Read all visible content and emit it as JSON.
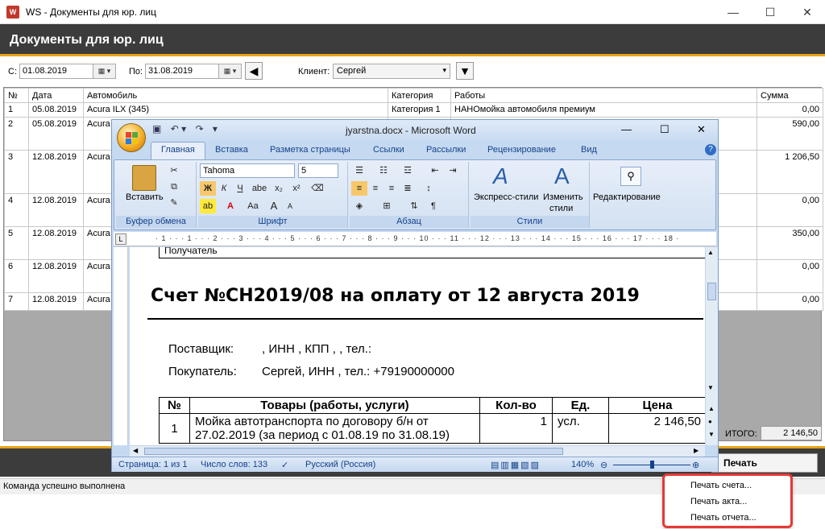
{
  "window": {
    "icon_text": "W",
    "title": "WS - Документы для юр. лиц",
    "minimize": "—",
    "maximize": "☐",
    "close": "✕"
  },
  "header": {
    "title": "Документы для юр. лиц"
  },
  "filters": {
    "from_label": "С:",
    "from_value": "01.08.2019",
    "to_label": "По:",
    "to_value": "31.08.2019",
    "client_label": "Клиент:",
    "client_value": "Сергей"
  },
  "table": {
    "columns": [
      "№",
      "Дата",
      "Автомобиль",
      "Категория",
      "Работы",
      "Сумма"
    ],
    "rows": [
      {
        "n": "1",
        "date": "05.08.2019",
        "car": "Acura ILX (345)",
        "cat": "Категория 1",
        "work": "НАНОмойка автомобиля премиум",
        "sum": "0,00"
      },
      {
        "n": "2",
        "date": "05.08.2019",
        "car": "Acura",
        "cat": "",
        "work": "",
        "sum": "590,00"
      },
      {
        "n": "3",
        "date": "12.08.2019",
        "car": "Acura",
        "cat": "",
        "work": "",
        "sum": "1 206,50"
      },
      {
        "n": "4",
        "date": "12.08.2019",
        "car": "Acura",
        "cat": "",
        "work": "",
        "sum": "0,00"
      },
      {
        "n": "5",
        "date": "12.08.2019",
        "car": "Acura",
        "cat": "",
        "work": "",
        "sum": "350,00"
      },
      {
        "n": "6",
        "date": "12.08.2019",
        "car": "Acura",
        "cat": "",
        "work": "",
        "sum": "0,00"
      },
      {
        "n": "7",
        "date": "12.08.2019",
        "car": "Acura",
        "cat": "",
        "work": "",
        "sum": "0,00"
      }
    ]
  },
  "totals": {
    "label": "ИТОГО:",
    "value": "2 146,50"
  },
  "print_button": "Печать",
  "status": "Команда успешно выполнена",
  "print_menu": [
    "Печать счета...",
    "Печать акта...",
    "Печать отчета..."
  ],
  "word": {
    "title": "jyarstna.docx - Microsoft Word",
    "tabs": [
      "Главная",
      "Вставка",
      "Разметка страницы",
      "Ссылки",
      "Рассылки",
      "Рецензирование",
      "Вид"
    ],
    "groups": {
      "clipboard": "Буфер обмена",
      "font": "Шрифт",
      "paragraph": "Абзац",
      "styles": "Стили",
      "paste": "Вставить",
      "express_styles": "Экспресс-стили",
      "change_styles_1": "Изменить",
      "change_styles_2": "стили",
      "editing": "Редактирование"
    },
    "font_name": "Tahoma",
    "font_size": "5",
    "ruler_text": "· 1 · · · 1 · · · 2 · · · 3 · · · 4 · · · 5 · · · 6 · · · 7 · · · 8 · · · 9 · · · 10 · · · 11 · · · 12 · · · 13 · · · 14 · · · 15 · · · 16 · · · 17 · · · 18 ·",
    "doc": {
      "prev_text": "Получатель",
      "heading": "Счет №СН2019/08 на оплату от 12 августа 2019",
      "supplier_label": "Поставщик:",
      "supplier_value": ", ИНН , КПП , , тел.:",
      "buyer_label": "Покупатель:",
      "buyer_value": "Сергей, ИНН , тел.: +79190000000",
      "table_headers": [
        "№",
        "Товары (работы, услуги)",
        "Кол-во",
        "Ед.",
        "Цена"
      ],
      "row1": {
        "n": "1",
        "name": "Мойка автотранспорта по договору б/н от",
        "name2": "27.02.2019 (за период с 01.08.19 по 31.08.19)",
        "qty": "1",
        "unit": "усл.",
        "price": "2 146,50"
      }
    },
    "status": {
      "page": "Страница: 1 из 1",
      "words": "Число слов: 133",
      "lang": "Русский (Россия)",
      "zoom": "140%"
    }
  }
}
